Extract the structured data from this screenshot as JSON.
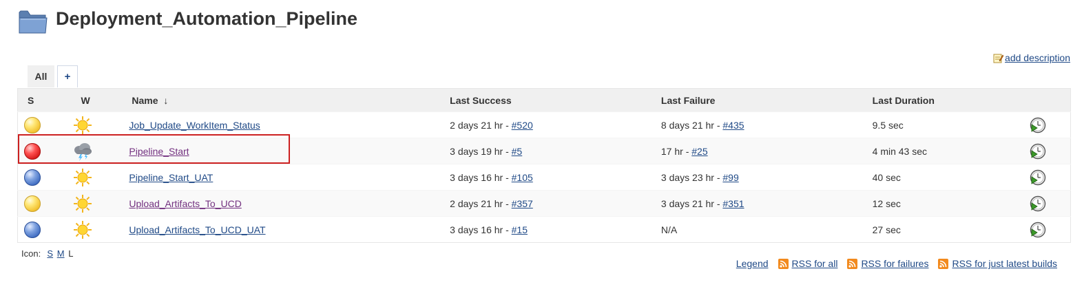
{
  "page": {
    "title": "Deployment_Automation_Pipeline",
    "add_description": "add description",
    "folder_icon": "folder-icon"
  },
  "tabs": [
    {
      "label": "All",
      "active": true
    },
    {
      "label": "+",
      "active": false
    }
  ],
  "table": {
    "headers": {
      "status": "S",
      "weather": "W",
      "name": "Name",
      "sort_indicator": "↓",
      "last_success": "Last Success",
      "last_failure": "Last Failure",
      "last_duration": "Last Duration"
    },
    "rows": [
      {
        "status": "yellow",
        "weather": "sunny",
        "name": "Job_Update_WorkItem_Status",
        "success_text": "2 days 21 hr - ",
        "success_build": "#520",
        "failure_text": "8 days 21 hr - ",
        "failure_build": "#435",
        "duration": "9.5 sec"
      },
      {
        "status": "red",
        "weather": "thunderstorm",
        "name": "Pipeline_Start",
        "success_text": "3 days 19 hr - ",
        "success_build": "#5",
        "failure_text": "17 hr - ",
        "failure_build": "#25",
        "duration": "4 min 43 sec"
      },
      {
        "status": "blue",
        "weather": "sunny",
        "name": "Pipeline_Start_UAT",
        "success_text": "3 days 16 hr - ",
        "success_build": "#105",
        "failure_text": "3 days 23 hr - ",
        "failure_build": "#99",
        "duration": "40 sec"
      },
      {
        "status": "yellow",
        "weather": "sunny",
        "name": "Upload_Artifacts_To_UCD",
        "success_text": "2 days 21 hr - ",
        "success_build": "#357",
        "failure_text": "3 days 21 hr - ",
        "failure_build": "#351",
        "duration": "12 sec"
      },
      {
        "status": "blue",
        "weather": "sunny",
        "name": "Upload_Artifacts_To_UCD_UAT",
        "success_text": "3 days 16 hr - ",
        "success_build": "#15",
        "failure_text": "N/A",
        "failure_build": "",
        "duration": "27 sec"
      }
    ]
  },
  "icon_size": {
    "label": "Icon:",
    "small": "S",
    "medium": "M",
    "large": "L"
  },
  "footer": {
    "legend": "Legend",
    "rss_all": "RSS for all",
    "rss_failures": "RSS for failures",
    "rss_latest": "RSS for just latest builds"
  },
  "colors": {
    "link": "#204a87",
    "visited_link": "#72307f",
    "highlight": "#cc2020",
    "header_bg": "#f0f0f0"
  }
}
